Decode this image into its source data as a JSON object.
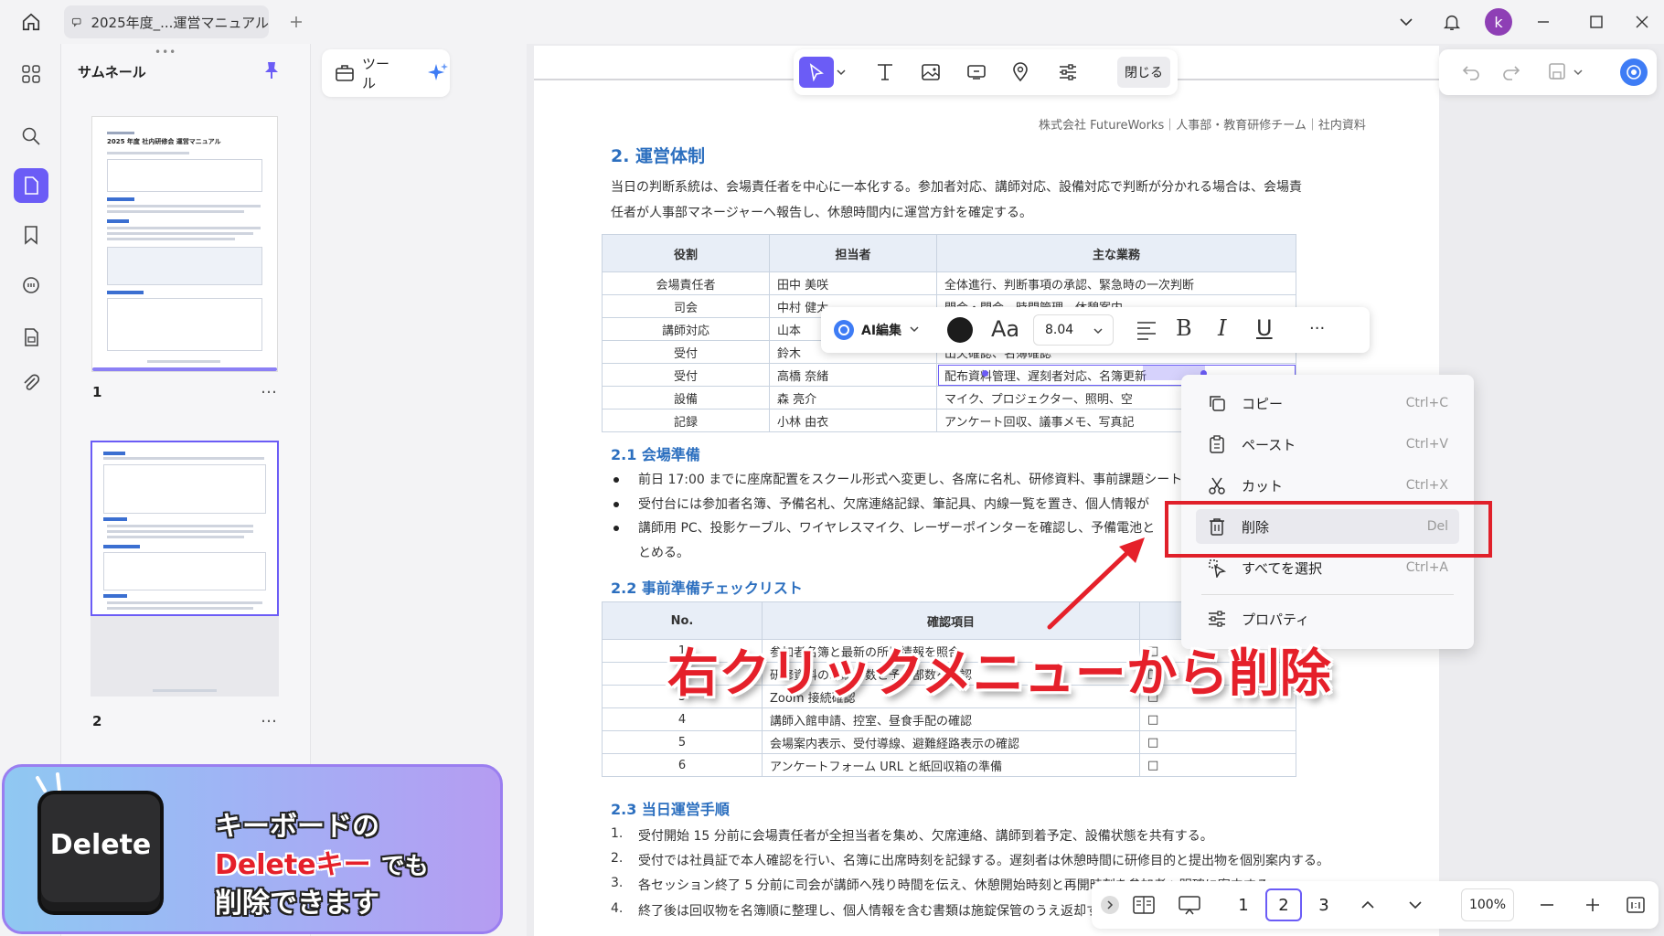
{
  "titlebar": {
    "tab_title": "2025年度_...運営マニュアル",
    "avatar_letter": "k"
  },
  "thumbnails": {
    "title": "サムネール",
    "pages": [
      {
        "number": "1",
        "more": "…"
      },
      {
        "number": "2",
        "more": "…"
      }
    ],
    "mini_title": "2025 年度 社内研修会 運営マニュアル"
  },
  "tools_panel": {
    "tool_label": "ツール"
  },
  "main_toolbar": {
    "close_label": "閉じる"
  },
  "document": {
    "header_note": "株式会社 FutureWorks｜人事部・教育研修チーム｜社内資料",
    "section_title": "2. 運営体制",
    "intro_line1": "当日の判断系統は、会場責任者を中心に一本化する。参加者対応、講師対応、設備対応で判断が分かれる場合は、会場責",
    "intro_line2": "任者が人事部マネージャーへ報告し、休憩時間内に運営方針を確定する。",
    "roles_table": {
      "headers": [
        "役割",
        "担当者",
        "主な業務"
      ],
      "rows": [
        [
          "会場責任者",
          "田中 美咲",
          "全体進行、判断事項の承認、緊急時の一次判断"
        ],
        [
          "司会",
          "中村 健太",
          "開会・閉会、時間管理、休憩案内"
        ],
        [
          "講師対応",
          "山本",
          ""
        ],
        [
          "受付",
          "鈴木",
          "出欠確認、名簿確認"
        ],
        [
          "受付",
          "高橋 奈緒",
          "配布資料管理、遅刻者対応、名簿更新"
        ],
        [
          "設備",
          "森 亮介",
          "マイク、プロジェクター、照明、空"
        ],
        [
          "記録",
          "小林 由衣",
          "アンケート回収、議事メモ、写真記"
        ]
      ]
    },
    "sub1_title": "2.1 会場準備",
    "sub1_items": [
      "前日 17:00 までに座席配置をスクール形式へ変更し、各席に名札、研修資料、事前課題シート",
      "受付台には参加者名簿、予備名札、欠席連絡記録、筆記具、内線一覧を置き、個人情報が",
      "講師用 PC、投影ケーブル、ワイヤレスマイク、レーザーポインターを確認し、予備電池と"
    ],
    "sub1_item3_cont": "とめる。",
    "sub2_title": "2.2 事前準備チェックリスト",
    "check_table": {
      "headers": [
        "No.",
        "確認項目",
        ""
      ],
      "rows": [
        [
          "1",
          "参加者名簿と最新の所属情報を照合",
          "□"
        ],
        [
          "2",
          "研修資料の印刷部数と予備部数を確認",
          "□"
        ],
        [
          "3",
          "Zoom 接続確認",
          "□"
        ],
        [
          "4",
          "講師入館申請、控室、昼食手配の確認",
          "□"
        ],
        [
          "5",
          "会場案内表示、受付導線、避難経路表示の確認",
          "□"
        ],
        [
          "6",
          "アンケートフォーム URL と紙回収箱の準備",
          "□"
        ]
      ]
    },
    "sub3_title": "2.3 当日運営手順",
    "sub3_items": [
      {
        "n": "1.",
        "text": "受付開始 15 分前に会場責任者が全担当者を集め、欠席連絡、講師到着予定、設備状態を共有する。"
      },
      {
        "n": "2.",
        "text": "受付では社員証で本人確認を行い、名簿に出席時刻を記録する。遅刻者は休憩時間に研修目的と提出物を個別案内する。"
      },
      {
        "n": "3.",
        "text": "各セッション終了 5 分前に司会が講師へ残り時間を伝え、休憩開始時刻と再開時刻を参加者へ明確に案内する。"
      },
      {
        "n": "4.",
        "text": "終了後は回収物を名簿順に整理し、個人情報を含む書類は施錠保管のうえ返却する。"
      }
    ]
  },
  "format_toolbar": {
    "ai_label": "AI編集",
    "font_label": "Aa",
    "font_size": "8.04",
    "bold": "B",
    "italic": "I",
    "underline": "U",
    "more": "···"
  },
  "context_menu": {
    "items": [
      {
        "label": "コピー",
        "shortcut": "Ctrl+C"
      },
      {
        "label": "ペースト",
        "shortcut": "Ctrl+V"
      },
      {
        "label": "カット",
        "shortcut": "Ctrl+X"
      },
      {
        "label": "削除",
        "shortcut": "Del"
      },
      {
        "label": "すべてを選択",
        "shortcut": "Ctrl+A"
      },
      {
        "label": "プロパティ",
        "shortcut": ""
      }
    ]
  },
  "annotation": {
    "caption": "右クリックメニューから削除"
  },
  "promo": {
    "key_label": "Delete",
    "line1": "キーボードの",
    "line2_red": "Deleteキー",
    "line2_rest": "でも",
    "line3": "削除できます"
  },
  "bottom_nav": {
    "pages": [
      "1",
      "2",
      "3"
    ],
    "zoom": "100%"
  },
  "colors": {
    "accent": "#6b5cf6",
    "heading": "#2c6fbf",
    "alert": "#e5202a"
  }
}
